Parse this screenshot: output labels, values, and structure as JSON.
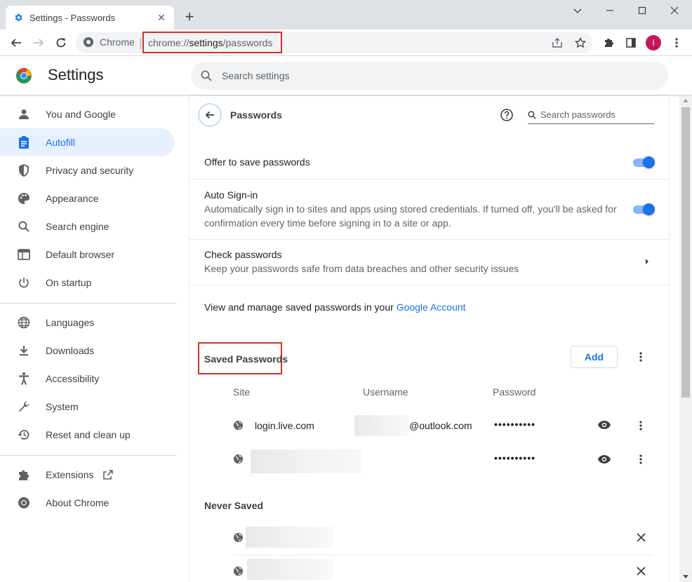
{
  "tab": {
    "title": "Settings - Passwords",
    "close": "✕",
    "new": "+"
  },
  "toolbar": {
    "chip_label": "Chrome",
    "url_host": "chrome://",
    "url_path": "settings",
    "url_rest": "/passwords",
    "avatar_letter": "I"
  },
  "settings_header": {
    "title": "Settings",
    "search_placeholder": "Search settings"
  },
  "sidebar": {
    "items": [
      {
        "label": "You and Google",
        "icon": "person-icon"
      },
      {
        "label": "Autofill",
        "icon": "clipboard-icon",
        "active": true
      },
      {
        "label": "Privacy and security",
        "icon": "shield-icon"
      },
      {
        "label": "Appearance",
        "icon": "palette-icon"
      },
      {
        "label": "Search engine",
        "icon": "search-icon"
      },
      {
        "label": "Default browser",
        "icon": "browser-icon"
      },
      {
        "label": "On startup",
        "icon": "power-icon"
      },
      {
        "label": "Languages",
        "icon": "globe-icon"
      },
      {
        "label": "Downloads",
        "icon": "download-icon"
      },
      {
        "label": "Accessibility",
        "icon": "accessibility-icon"
      },
      {
        "label": "System",
        "icon": "wrench-icon"
      },
      {
        "label": "Reset and clean up",
        "icon": "restore-icon"
      },
      {
        "label": "Extensions",
        "icon": "puzzle-icon"
      },
      {
        "label": "About Chrome",
        "icon": "chrome-icon"
      }
    ]
  },
  "passwords": {
    "title": "Passwords",
    "search_placeholder": "Search passwords",
    "offer_to_save": "Offer to save passwords",
    "auto_signin_title": "Auto Sign-in",
    "auto_signin_desc_1": "Automatically sign in to sites and apps using stored credentials. If turned off, you'll be asked for",
    "auto_signin_desc_2": "confirmation every time before signing in to a site or app.",
    "check_title": "Check passwords",
    "check_desc": "Keep your passwords safe from data breaches and other security issues",
    "manage_text": "View and manage saved passwords in your ",
    "manage_link": "Google Account",
    "saved_title": "Saved Passwords",
    "add_label": "Add",
    "columns": {
      "site": "Site",
      "username": "Username",
      "password": "Password"
    },
    "rows": [
      {
        "site": "login.live.com",
        "username_suffix": "@outlook.com",
        "password": "••••••••••"
      },
      {
        "site": "",
        "username_suffix": "",
        "password": "••••••••••"
      }
    ],
    "never_saved_title": "Never Saved"
  },
  "colors": {
    "accent": "#1a73e8",
    "highlight": "#d93025"
  }
}
